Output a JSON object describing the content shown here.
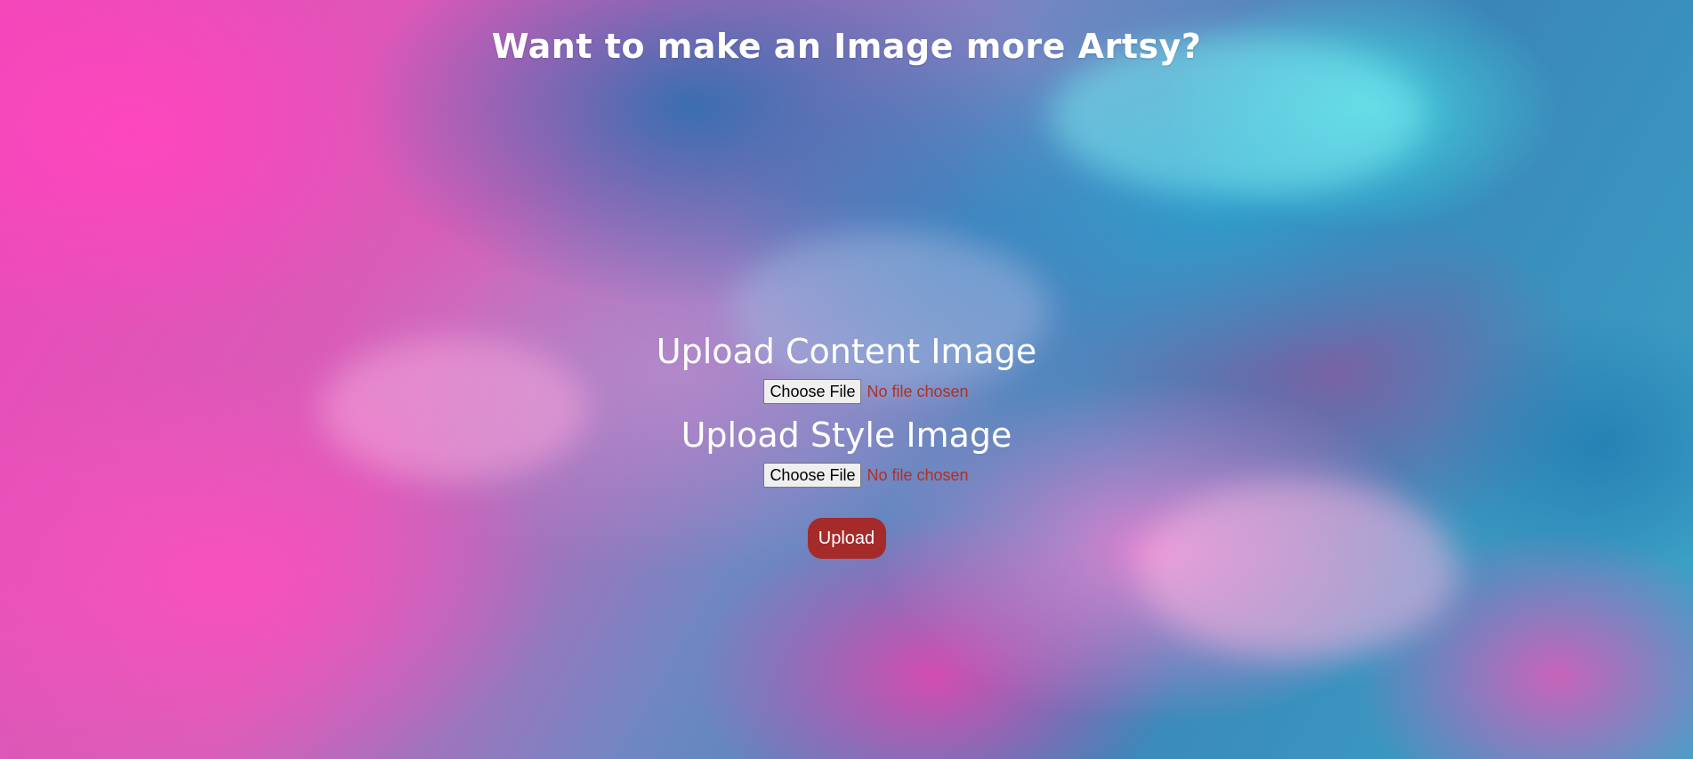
{
  "header": {
    "title": "Want to make an Image more Artsy?"
  },
  "form": {
    "content": {
      "label": "Upload Content Image",
      "button_label": "Choose File",
      "status": "No file chosen"
    },
    "style": {
      "label": "Upload Style Image",
      "button_label": "Choose File",
      "status": "No file chosen"
    },
    "submit_label": "Upload"
  },
  "colors": {
    "submit_button": "#a52a2a",
    "status_text": "#b03024",
    "heading_text": "#ffffff"
  }
}
